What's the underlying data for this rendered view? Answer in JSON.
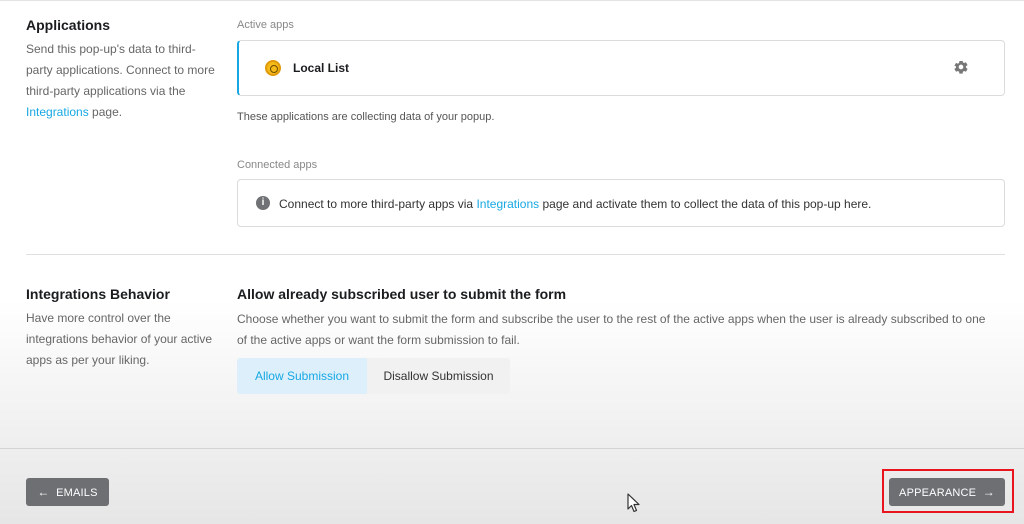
{
  "applications": {
    "title": "Applications",
    "desc_before": "Send this pop-up's data to third-party applications. Connect to more third-party applications via the ",
    "desc_link": "Integrations",
    "desc_after": " page.",
    "active_label": "Active apps",
    "active_app": {
      "name": "Local List",
      "icon": "local-list-icon"
    },
    "settings_icon": "gear-icon",
    "active_note": "These applications are collecting data of your popup.",
    "connected_label": "Connected apps",
    "connected_before": "Connect to more third-party apps via ",
    "connected_link": "Integrations",
    "connected_after": " page and activate them to collect the data of this pop-up here.",
    "info_icon": "info-icon",
    "info_glyph": "i"
  },
  "behavior": {
    "title": "Integrations Behavior",
    "desc": "Have more control over the integrations behavior of your active apps as per your liking.",
    "heading": "Allow already subscribed user to submit the form",
    "detail": "Choose whether you want to submit the form and subscribe the user to the rest of the active apps when the user is already subscribed to one of the active apps or want the form submission to fail.",
    "options": [
      "Allow Submission",
      "Disallow Submission"
    ],
    "selected": "Allow Submission"
  },
  "footer": {
    "back_label": "EMAILS",
    "back_arrow": "←",
    "next_label": "APPEARANCE",
    "next_arrow": "→"
  },
  "colors": {
    "accent": "#17a8e3",
    "button": "#6d6f72",
    "highlight": "#e8141e"
  }
}
